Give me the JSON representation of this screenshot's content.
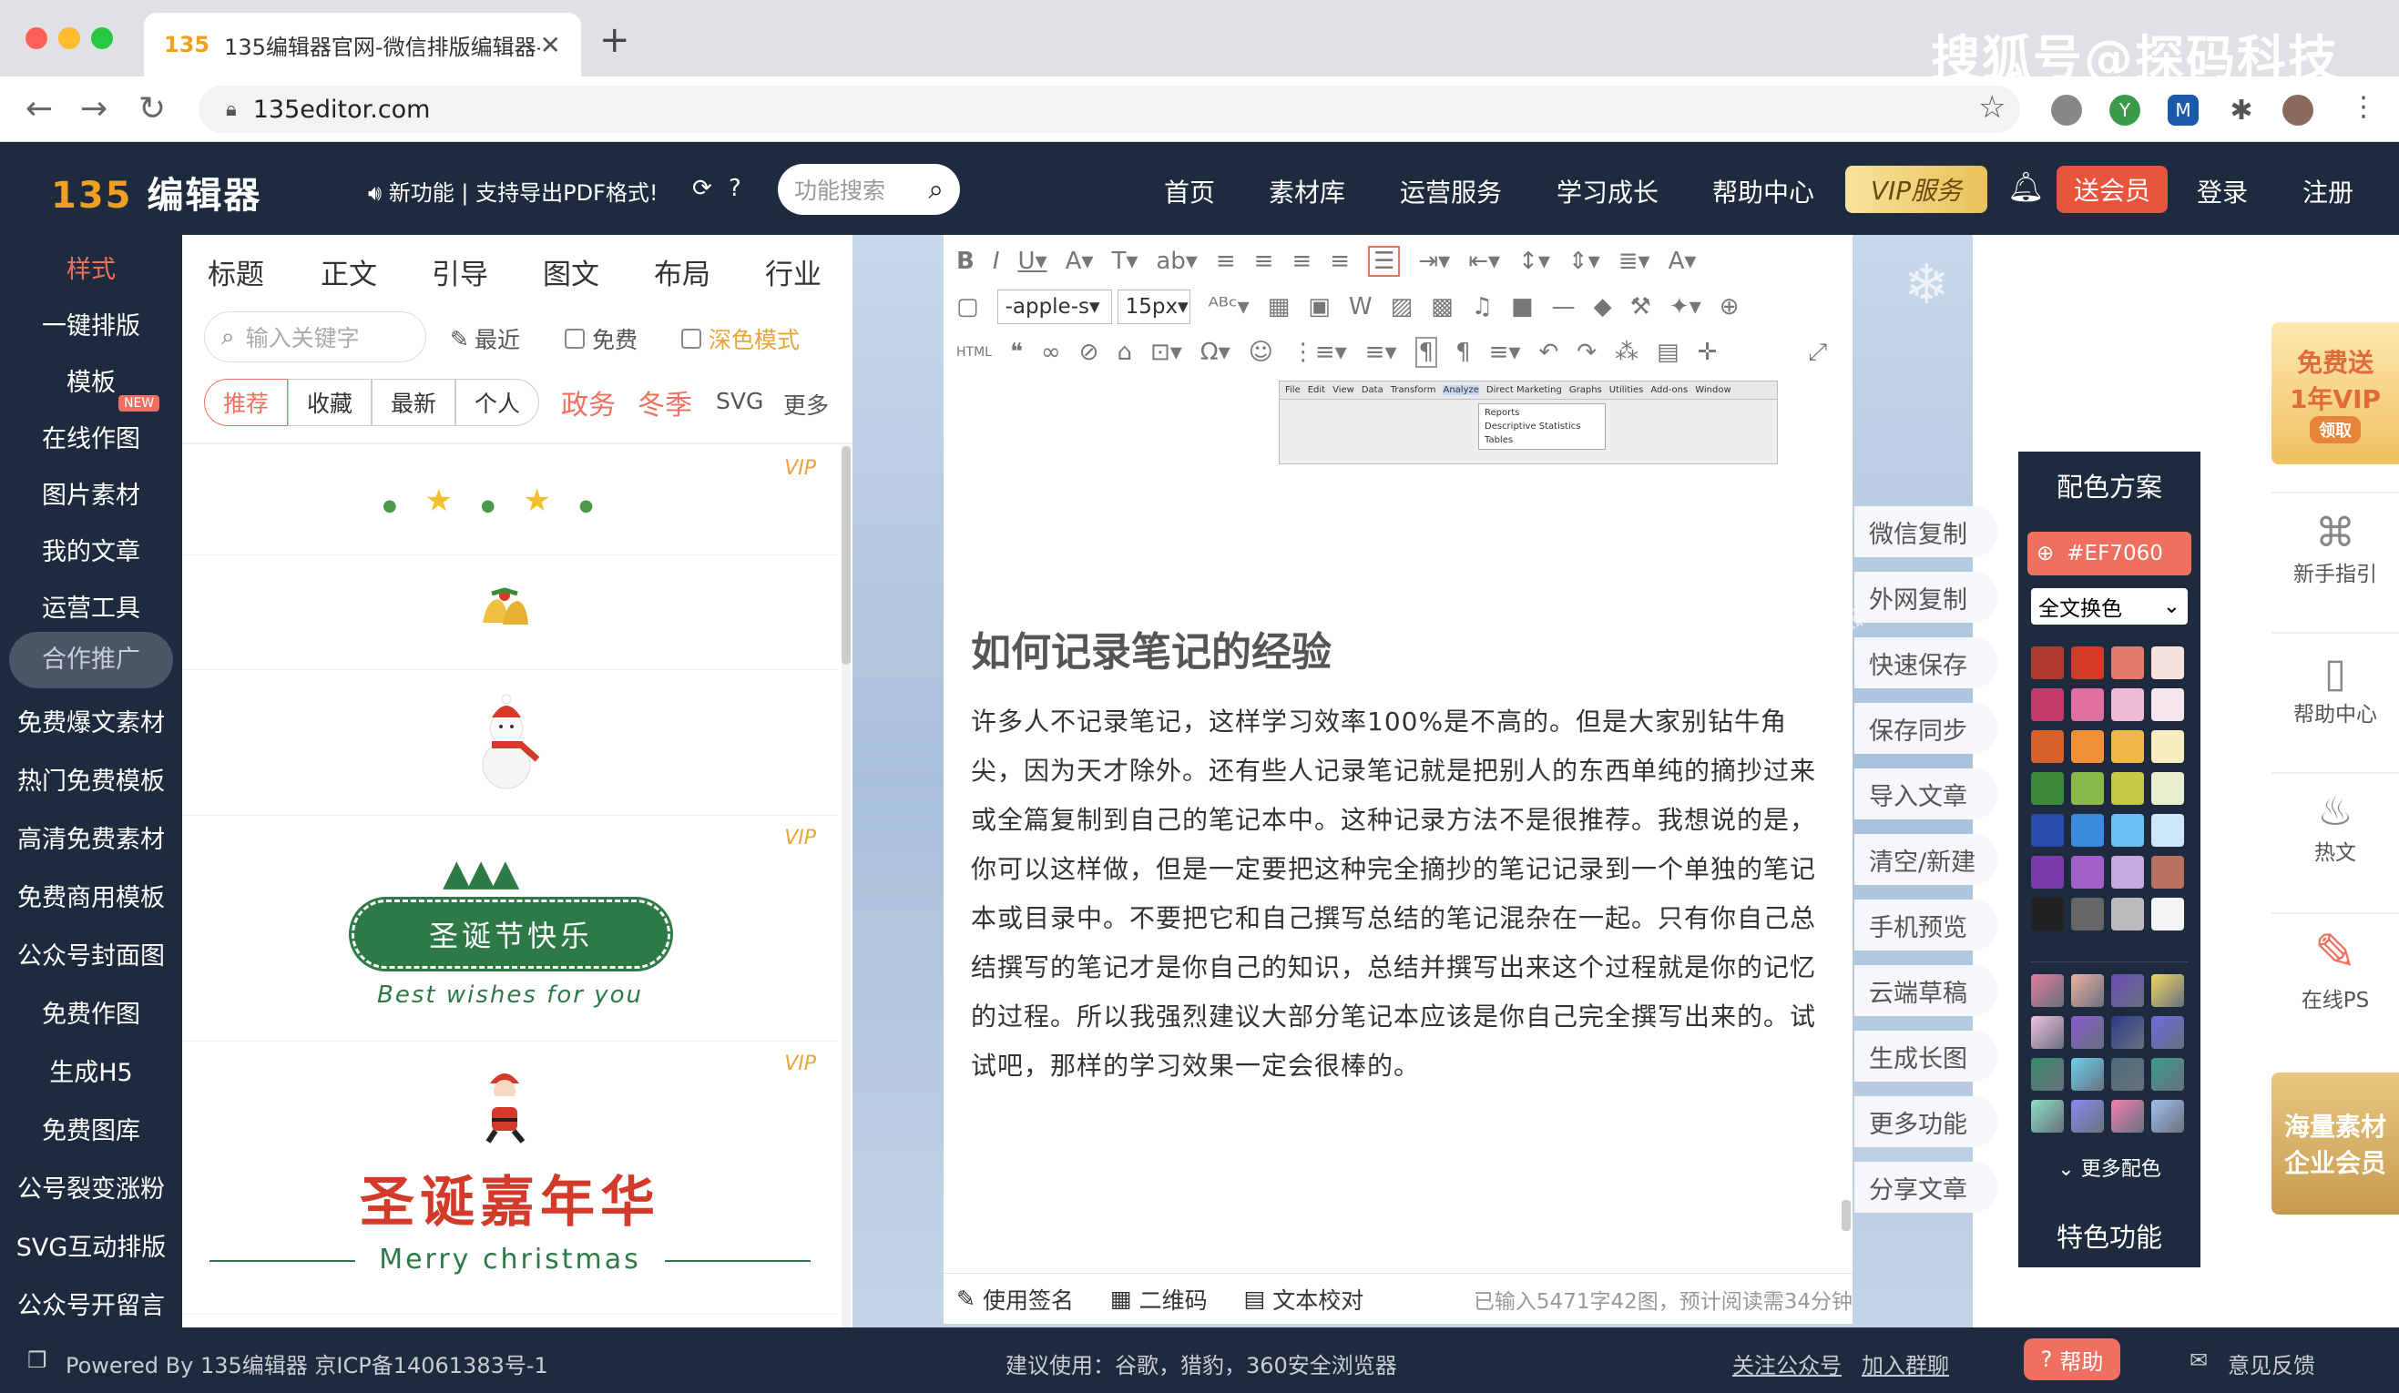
{
  "browser": {
    "tab_title": "135编辑器官网-微信排版编辑器-",
    "tab_favicon": "135",
    "url": "135editor.com",
    "watermark": "搜狐号@探码科技"
  },
  "header": {
    "logo_num": "135",
    "logo_text": "编辑器",
    "notice": "新功能 | 支持导出PDF格式!",
    "search_placeholder": "功能搜索",
    "nav": [
      "首页",
      "素材库",
      "运营服务",
      "学习成长",
      "帮助中心"
    ],
    "vip": "VIP服务",
    "gift": "送会员",
    "login": "登录",
    "register": "注册"
  },
  "sidebar": {
    "items": [
      "样式",
      "一键排版",
      "模板",
      "在线作图",
      "图片素材",
      "我的文章",
      "运营工具",
      "合作推广",
      "免费爆文素材",
      "热门免费模板",
      "高清免费素材",
      "免费商用模板",
      "公众号封面图",
      "免费作图",
      "生成H5",
      "免费图库",
      "公号裂变涨粉",
      "SVG互动排版",
      "公众号开留言"
    ],
    "new_badge": "NEW"
  },
  "panel": {
    "tabs": [
      "标题",
      "正文",
      "引导",
      "图文",
      "布局",
      "行业"
    ],
    "search_placeholder": "输入关键字",
    "recent": "最近",
    "free": "免费",
    "dark": "深色模式",
    "filters": [
      "推荐",
      "收藏",
      "最新",
      "个人"
    ],
    "cats": [
      "政务",
      "冬季",
      "SVG",
      "更多"
    ],
    "vip_label": "VIP",
    "xmas_title": "圣诞节快乐",
    "xmas_sub": "Best wishes for you",
    "carnival_title": "圣诞嘉年华",
    "carnival_sub": "Merry christmas"
  },
  "toolbar": {
    "font": "-apple-s",
    "size": "15px"
  },
  "document": {
    "title": "如何记录笔记的经验",
    "body": "许多人不记录笔记，这样学习效率100%是不高的。但是大家别钻牛角尖，因为天才除外。还有些人记录笔记就是把别人的东西单纯的摘抄过来或全篇复制到自己的笔记本中。这种记录方法不是很推荐。我想说的是，你可以这样做，但是一定要把这种完全摘抄的笔记记录到一个单独的笔记本或目录中。不要把它和自己撰写总结的笔记混杂在一起。只有你自己总结撰写的笔记才是你自己的知识，总结并撰写出来这个过程就是你的记忆的过程。所以我强烈建议大部分笔记本应该是你自己完全撰写出来的。试试吧，那样的学习效果一定会很棒的。",
    "menu": [
      "File",
      "Edit",
      "View",
      "Data",
      "Transform",
      "Analyze",
      "Direct Marketing",
      "Graphs",
      "Utilities",
      "Add-ons",
      "Window"
    ],
    "submenu": [
      "Reports",
      "Descriptive Statistics",
      "Tables"
    ]
  },
  "editor_footer": {
    "signature": "使用签名",
    "qrcode": "二维码",
    "proofread": "文本校对",
    "stats": "已输入5471字42图，预计阅读需34分钟"
  },
  "actions": [
    "微信复制",
    "外网复制",
    "快速保存",
    "保存同步",
    "导入文章",
    "清空/新建",
    "手机预览",
    "云端草稿",
    "生成长图",
    "更多功能",
    "分享文章"
  ],
  "color_panel": {
    "title": "配色方案",
    "current": "#EF7060",
    "select": "全文换色",
    "more": "更多配色",
    "special": "特色功能",
    "swatches": [
      "#b03a2e",
      "#d33a2a",
      "#e07a6a",
      "#f6e0dc",
      "#c43a6a",
      "#e070a0",
      "#ecbcd4",
      "#f6e6ee",
      "#d4602a",
      "#f0903a",
      "#f0b848",
      "#f6eec0",
      "#3a8a3a",
      "#8ab848",
      "#c8c848",
      "#e8f0d0",
      "#2a4aa8",
      "#3a8ae0",
      "#6ac0f0",
      "#cce8f8",
      "#7a3aa8",
      "#a060c8",
      "#c8a8e0",
      "#b87060",
      "#222222",
      "#666666",
      "#bbbbbb",
      "#f5f5f5"
    ],
    "gradients": [
      "#e07a9a",
      "#f0b0a0",
      "#6a4ab8",
      "#f0d860",
      "#f0c0e0",
      "#8a5ad0",
      "#2a3a8a",
      "#6a6ae0",
      "#3a8a6a",
      "#6ad0f0",
      "#4a6a7a",
      "#3a9a8a",
      "#8ae0c0",
      "#8a8af0",
      "#f080b0",
      "#a0c0f0"
    ]
  },
  "far_right": {
    "promo_top": [
      "免费送",
      "1年VIP",
      "领取"
    ],
    "items": [
      "新手指引",
      "帮助中心",
      "热文",
      "在线PS"
    ],
    "promo_bottom": [
      "海量素材",
      "企业会员"
    ]
  },
  "footer": {
    "powered": "Powered By 135编辑器 京ICP备14061383号-1",
    "browsers": "建议使用：谷歌，猎豹，360安全浏览器",
    "follow": "关注公众号",
    "join": "加入群聊",
    "help": "帮助",
    "feedback": "意见反馈"
  }
}
